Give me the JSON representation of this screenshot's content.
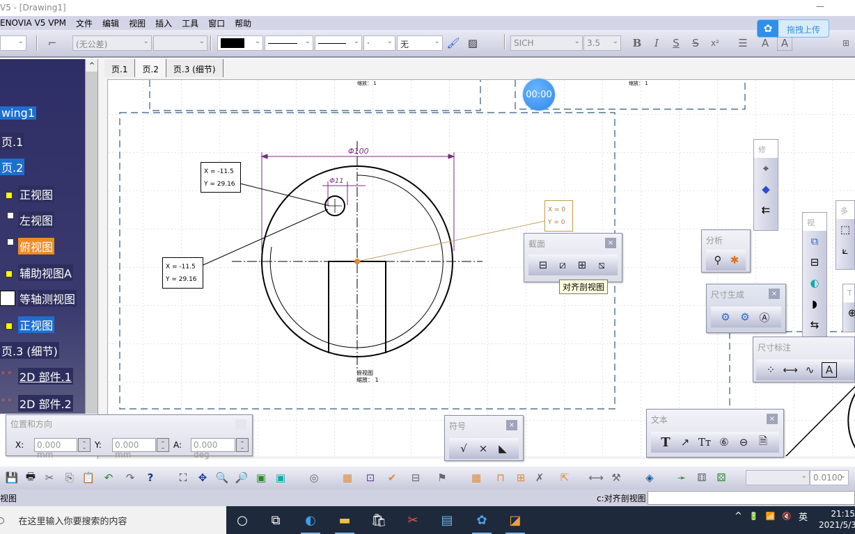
{
  "window": {
    "title": "V5 - [Drawing1]",
    "minimize": "—",
    "maximize": "☐"
  },
  "menu": [
    "ENOVIA V5 VPM",
    "文件",
    "编辑",
    "视图",
    "插入",
    "工具",
    "窗口",
    "帮助"
  ],
  "toolbar_top": {
    "tolerance": "(无公差)",
    "line_color": "#000000",
    "point_style": "·",
    "fill": "无",
    "font_name": "SICH",
    "font_size": "3.5",
    "bold": "B",
    "italic": "I",
    "underline": "S",
    "strike": "S",
    "superscript": "x²"
  },
  "upload_widget": {
    "label": "拖拽上传"
  },
  "tree": {
    "items": [
      {
        "label": "wing1",
        "state": "selected"
      },
      {
        "label": "页.1",
        "state": "normal"
      },
      {
        "label": "页.2",
        "state": "selected"
      },
      {
        "label": "正视图",
        "state": "normal"
      },
      {
        "label": "左视图",
        "state": "normal"
      },
      {
        "label": "俯视图",
        "state": "highlighted"
      },
      {
        "label": "辅助视图A",
        "state": "normal"
      },
      {
        "label": "等轴测视图",
        "state": "normal"
      },
      {
        "label": "正视图",
        "state": "selected"
      },
      {
        "label": "页.3 (细节)",
        "state": "normal"
      },
      {
        "label": "2D 部件.1",
        "state": "normal"
      },
      {
        "label": "2D 部件.2",
        "state": "normal"
      }
    ]
  },
  "sheet_tabs": [
    {
      "label": "页.1",
      "active": false
    },
    {
      "label": "页.2",
      "active": true
    },
    {
      "label": "页.3 (细节)",
      "active": false
    }
  ],
  "drawing": {
    "dim_outer": "Φ100",
    "dim_hole": "Φ11",
    "coord_box_1": {
      "x": "X = -11.5",
      "y": "Y = 29.16"
    },
    "coord_box_2": {
      "x": "X = -11.5",
      "y": "Y = 29.16"
    },
    "coord_box_origin": {
      "x": "X = 0",
      "y": "Y = 0"
    },
    "view_label_line1": "俯视图",
    "view_label_line2": "缩放： 1",
    "top_label_1": "缩放： 1",
    "top_label_2": "缩放： 1"
  },
  "timer": "00:00",
  "panels": {
    "section": {
      "title": "截面",
      "close": "×",
      "tooltip": "对齐剖视图"
    },
    "analysis": {
      "title": "分析"
    },
    "dim_generation": {
      "title": "尺寸生成",
      "close": "×"
    },
    "dimensioning": {
      "title": "尺寸标注"
    },
    "symbols": {
      "title": "符号",
      "close": "×"
    },
    "text": {
      "title": "文本",
      "close": "×"
    },
    "position": {
      "title": "位置和方向",
      "x_label": "X:",
      "x_value": "0.000 mm",
      "y_label": "Y:",
      "y_value": "0.000 mm",
      "a_label": "A:",
      "a_value": "0.000 deg"
    },
    "vertical_1": {
      "title": "修"
    },
    "vertical_2": {
      "title": "视"
    },
    "vertical_3": {
      "title": "多"
    },
    "vertical_4": {
      "title": "T"
    }
  },
  "bottom_toolbar": {
    "tolerance_value": "0.0100"
  },
  "status": {
    "left": "视图",
    "command_label": "c:对齐剖视图",
    "command_value": ""
  },
  "taskbar": {
    "search_placeholder": "在这里输入你要搜索的内容",
    "tray": [
      "^",
      "🔋",
      "📶",
      "🔇",
      "英"
    ],
    "time": "21:15",
    "date": "2021/5/3"
  }
}
